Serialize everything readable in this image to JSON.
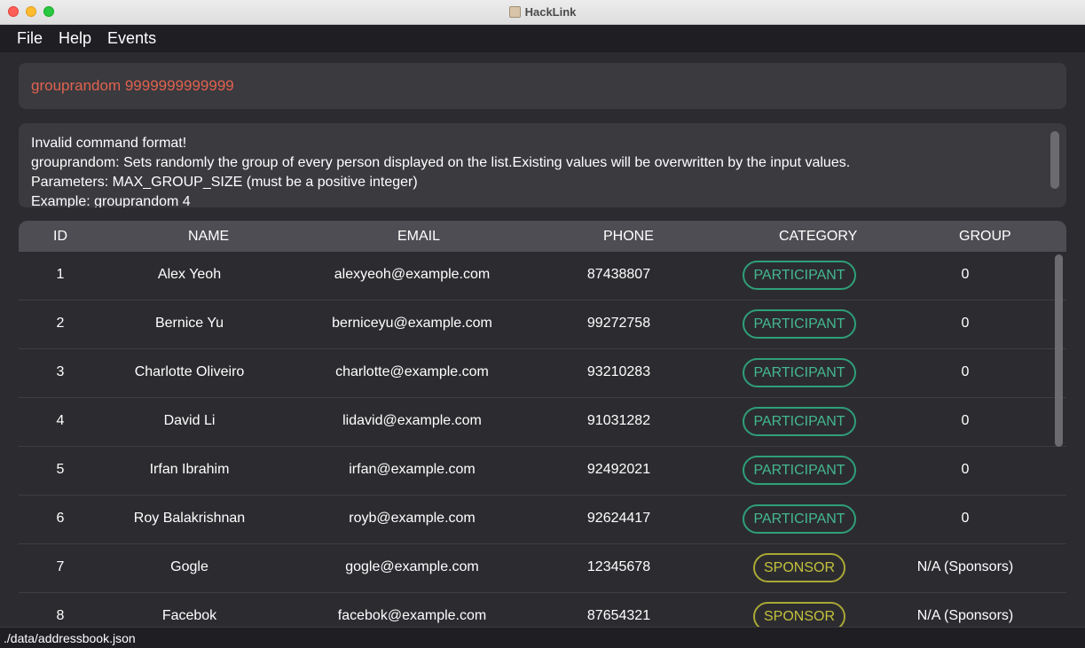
{
  "window": {
    "title": "HackLink"
  },
  "menu": [
    "File",
    "Help",
    "Events"
  ],
  "command": {
    "value": "grouprandom 9999999999999"
  },
  "result": {
    "lines": [
      "Invalid command format!",
      "grouprandom: Sets randomly the group of every person displayed on the list.Existing values will be overwritten by the input values.",
      "Parameters: MAX_GROUP_SIZE (must be a positive integer)",
      "Example: grouprandom 4"
    ]
  },
  "table": {
    "headers": {
      "id": "ID",
      "name": "NAME",
      "email": "EMAIL",
      "phone": "PHONE",
      "category": "CATEGORY",
      "group": "GROUP"
    },
    "rows": [
      {
        "id": "1",
        "name": "Alex Yeoh",
        "email": "alexyeoh@example.com",
        "phone": "87438807",
        "category": "PARTICIPANT",
        "group": "0"
      },
      {
        "id": "2",
        "name": "Bernice Yu",
        "email": "berniceyu@example.com",
        "phone": "99272758",
        "category": "PARTICIPANT",
        "group": "0"
      },
      {
        "id": "3",
        "name": "Charlotte Oliveiro",
        "email": "charlotte@example.com",
        "phone": "93210283",
        "category": "PARTICIPANT",
        "group": "0"
      },
      {
        "id": "4",
        "name": "David Li",
        "email": "lidavid@example.com",
        "phone": "91031282",
        "category": "PARTICIPANT",
        "group": "0"
      },
      {
        "id": "5",
        "name": "Irfan Ibrahim",
        "email": "irfan@example.com",
        "phone": "92492021",
        "category": "PARTICIPANT",
        "group": "0"
      },
      {
        "id": "6",
        "name": "Roy Balakrishnan",
        "email": "royb@example.com",
        "phone": "92624417",
        "category": "PARTICIPANT",
        "group": "0"
      },
      {
        "id": "7",
        "name": "Gogle",
        "email": "gogle@example.com",
        "phone": "12345678",
        "category": "SPONSOR",
        "group": "N/A (Sponsors)"
      },
      {
        "id": "8",
        "name": "Facebok",
        "email": "facebok@example.com",
        "phone": "87654321",
        "category": "SPONSOR",
        "group": "N/A (Sponsors)"
      }
    ]
  },
  "status": {
    "path": "./data/addressbook.json"
  },
  "colors": {
    "participant": "#44b88f",
    "sponsor": "#c3c23c",
    "command_text": "#e0624e",
    "background": "#2c2c30"
  }
}
